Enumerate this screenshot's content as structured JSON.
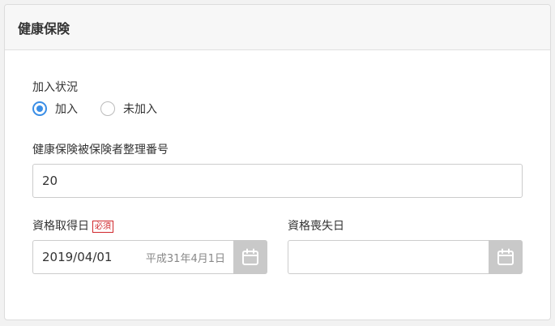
{
  "section": {
    "title": "健康保険"
  },
  "enrollment": {
    "label": "加入状況",
    "options": [
      {
        "label": "加入",
        "selected": true
      },
      {
        "label": "未加入",
        "selected": false
      }
    ]
  },
  "insurance_number": {
    "label": "健康保険被保険者整理番号",
    "value": "20"
  },
  "acquisition_date": {
    "label": "資格取得日",
    "required_badge": "必須",
    "value": "2019/04/01",
    "era_display": "平成31年4月1日"
  },
  "loss_date": {
    "label": "資格喪失日",
    "value": ""
  },
  "colors": {
    "accent": "#3a8ee6",
    "required": "#d0262b",
    "calendar_button": "#c9c9c9"
  },
  "icons": {
    "calendar": "calendar-icon"
  }
}
